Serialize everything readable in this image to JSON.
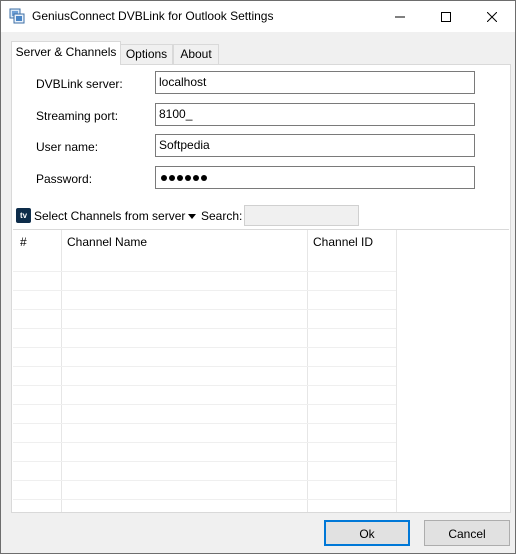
{
  "window": {
    "title": "GeniusConnect DVBLink for Outlook Settings",
    "icon": "monitor-app-icon",
    "controls": [
      "minimize-icon",
      "maximize-icon",
      "close-icon"
    ]
  },
  "tabs": [
    {
      "label": "Server & Channels",
      "active": true
    },
    {
      "label": "Options",
      "active": false
    },
    {
      "label": "About",
      "active": false
    }
  ],
  "form": {
    "server_label": "DVBLink server:",
    "server_value": "localhost",
    "port_label": "Streaming port:",
    "port_value": "8100_",
    "user_label": "User name:",
    "user_value": "Softpedia",
    "password_label": "Password:",
    "password_mask_count": 6
  },
  "toolbar": {
    "tv_icon_text": "tv",
    "select_label": "Select Channels from server",
    "search_label": "Search:",
    "search_value": ""
  },
  "grid": {
    "columns": [
      "#",
      "Channel Name",
      "Channel ID"
    ],
    "rows": []
  },
  "buttons": {
    "ok": "Ok",
    "cancel": "Cancel"
  },
  "colors": {
    "accent": "#0078d7",
    "window_bg": "#f0f0f0",
    "panel_bg": "#ffffff"
  }
}
